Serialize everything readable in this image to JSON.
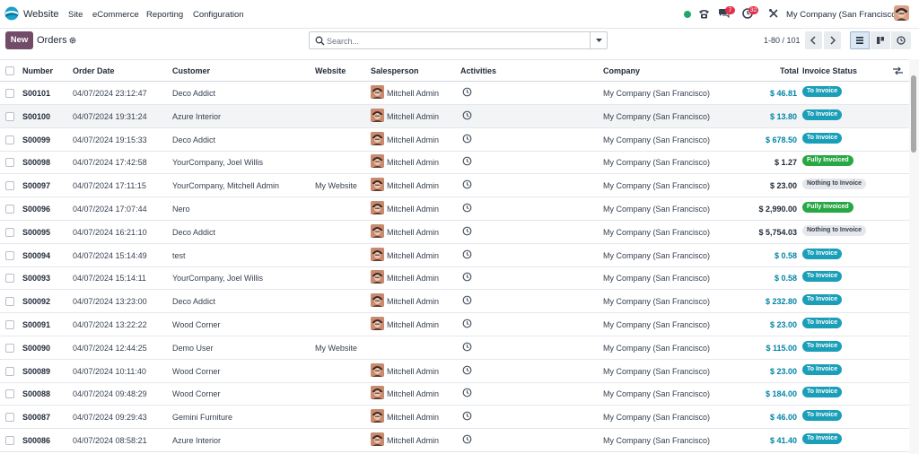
{
  "navbar": {
    "app_name": "Website",
    "menus": [
      "Site",
      "eCommerce",
      "Reporting",
      "Configuration"
    ],
    "messages_count": "7",
    "activities_count": "32",
    "company": "My Company (San Francisco)"
  },
  "control": {
    "new_label": "New",
    "breadcrumb": "Orders",
    "search_placeholder": "Search...",
    "pager": "1-80 / 101"
  },
  "columns": {
    "number": "Number",
    "order_date": "Order Date",
    "customer": "Customer",
    "website": "Website",
    "salesperson": "Salesperson",
    "activities": "Activities",
    "company": "Company",
    "total": "Total",
    "invoice_status": "Invoice Status"
  },
  "rows": [
    {
      "number": "S00101",
      "date": "04/07/2024 23:12:47",
      "customer": "Deco Addict",
      "website": "",
      "salesperson": "Mitchell Admin",
      "company": "My Company (San Francisco)",
      "total": "$ 46.81",
      "status": "To Invoice"
    },
    {
      "number": "S00100",
      "date": "04/07/2024 19:31:24",
      "customer": "Azure Interior",
      "website": "",
      "salesperson": "Mitchell Admin",
      "company": "My Company (San Francisco)",
      "total": "$ 13.80",
      "status": "To Invoice"
    },
    {
      "number": "S00099",
      "date": "04/07/2024 19:15:33",
      "customer": "Deco Addict",
      "website": "",
      "salesperson": "Mitchell Admin",
      "company": "My Company (San Francisco)",
      "total": "$ 678.50",
      "status": "To Invoice"
    },
    {
      "number": "S00098",
      "date": "04/07/2024 17:42:58",
      "customer": "YourCompany, Joel Willis",
      "website": "",
      "salesperson": "Mitchell Admin",
      "company": "My Company (San Francisco)",
      "total": "$ 1.27",
      "status": "Fully Invoiced"
    },
    {
      "number": "S00097",
      "date": "04/07/2024 17:11:15",
      "customer": "YourCompany, Mitchell Admin",
      "website": "My Website",
      "salesperson": "Mitchell Admin",
      "company": "My Company (San Francisco)",
      "total": "$ 23.00",
      "status": "Nothing to Invoice"
    },
    {
      "number": "S00096",
      "date": "04/07/2024 17:07:44",
      "customer": "Nero",
      "website": "",
      "salesperson": "Mitchell Admin",
      "company": "My Company (San Francisco)",
      "total": "$ 2,990.00",
      "status": "Fully Invoiced"
    },
    {
      "number": "S00095",
      "date": "04/07/2024 16:21:10",
      "customer": "Deco Addict",
      "website": "",
      "salesperson": "Mitchell Admin",
      "company": "My Company (San Francisco)",
      "total": "$ 5,754.03",
      "status": "Nothing to Invoice"
    },
    {
      "number": "S00094",
      "date": "04/07/2024 15:14:49",
      "customer": "test",
      "website": "",
      "salesperson": "Mitchell Admin",
      "company": "My Company (San Francisco)",
      "total": "$ 0.58",
      "status": "To Invoice"
    },
    {
      "number": "S00093",
      "date": "04/07/2024 15:14:11",
      "customer": "YourCompany, Joel Willis",
      "website": "",
      "salesperson": "Mitchell Admin",
      "company": "My Company (San Francisco)",
      "total": "$ 0.58",
      "status": "To Invoice"
    },
    {
      "number": "S00092",
      "date": "04/07/2024 13:23:00",
      "customer": "Deco Addict",
      "website": "",
      "salesperson": "Mitchell Admin",
      "company": "My Company (San Francisco)",
      "total": "$ 232.80",
      "status": "To Invoice"
    },
    {
      "number": "S00091",
      "date": "04/07/2024 13:22:22",
      "customer": "Wood Corner",
      "website": "",
      "salesperson": "Mitchell Admin",
      "company": "My Company (San Francisco)",
      "total": "$ 23.00",
      "status": "To Invoice"
    },
    {
      "number": "S00090",
      "date": "04/07/2024 12:44:25",
      "customer": "Demo User",
      "website": "My Website",
      "salesperson": "",
      "company": "My Company (San Francisco)",
      "total": "$ 115.00",
      "status": "To Invoice"
    },
    {
      "number": "S00089",
      "date": "04/07/2024 10:11:40",
      "customer": "Wood Corner",
      "website": "",
      "salesperson": "Mitchell Admin",
      "company": "My Company (San Francisco)",
      "total": "$ 23.00",
      "status": "To Invoice"
    },
    {
      "number": "S00088",
      "date": "04/07/2024 09:48:29",
      "customer": "Wood Corner",
      "website": "",
      "salesperson": "Mitchell Admin",
      "company": "My Company (San Francisco)",
      "total": "$ 184.00",
      "status": "To Invoice"
    },
    {
      "number": "S00087",
      "date": "04/07/2024 09:29:43",
      "customer": "Gemini Furniture",
      "website": "",
      "salesperson": "Mitchell Admin",
      "company": "My Company (San Francisco)",
      "total": "$ 46.00",
      "status": "To Invoice"
    },
    {
      "number": "S00086",
      "date": "04/07/2024 08:58:21",
      "customer": "Azure Interior",
      "website": "",
      "salesperson": "Mitchell Admin",
      "company": "My Company (San Francisco)",
      "total": "$ 41.40",
      "status": "To Invoice"
    }
  ],
  "colors": {
    "brand": "#714b67",
    "to_invoice": "#1b9fb8",
    "fully_invoiced": "#28a745",
    "total_blue": "#0184a7"
  }
}
